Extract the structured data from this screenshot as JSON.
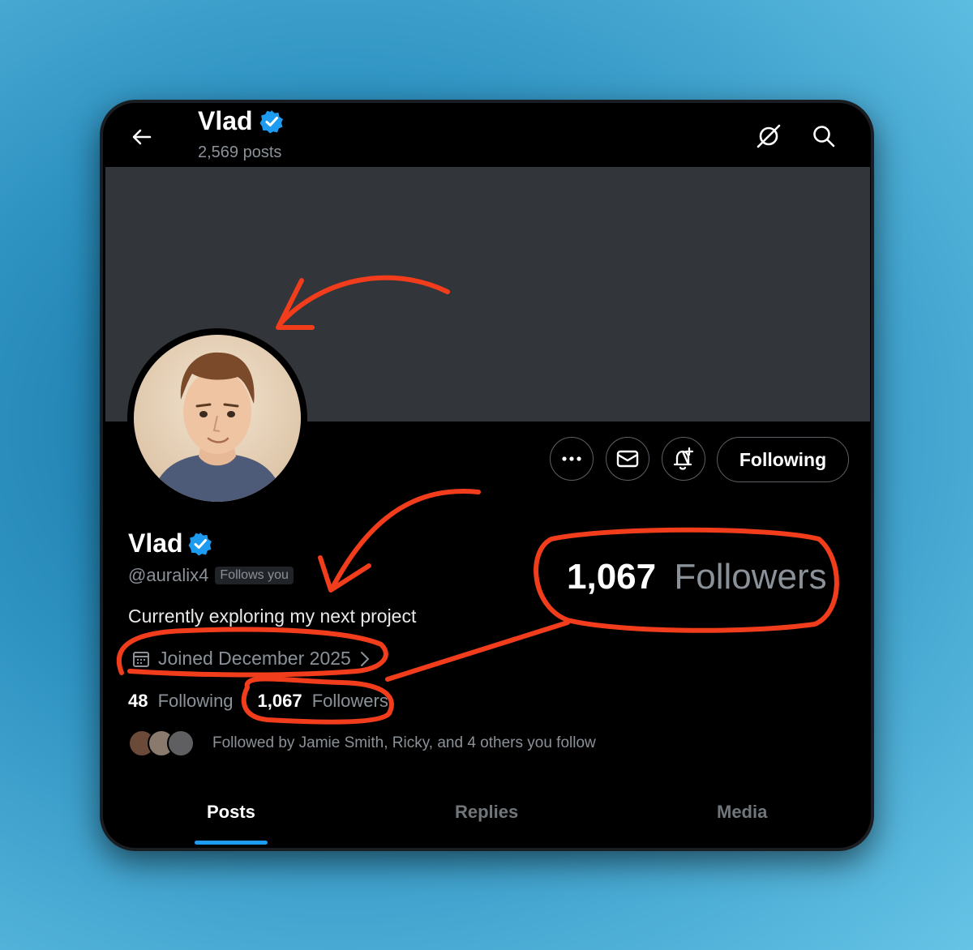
{
  "header": {
    "name": "Vlad",
    "posts_count": "2,569 posts"
  },
  "profile": {
    "name": "Vlad",
    "handle": "@auralix4",
    "follows_you": "Follows you",
    "bio": "Currently exploring my next project",
    "joined": "Joined December 2025",
    "following_count": "48",
    "following_label": "Following",
    "followers_count": "1,067",
    "followers_label": "Followers",
    "followed_by": "Followed by Jamie Smith, Ricky, and 4 others you follow"
  },
  "actions": {
    "follow_button": "Following"
  },
  "callout": {
    "followers_count": "1,067",
    "followers_label": "Followers"
  },
  "tabs": [
    {
      "label": "Posts",
      "active": true
    },
    {
      "label": "Replies",
      "active": false
    },
    {
      "label": "Media",
      "active": false
    }
  ],
  "icons": {
    "back": "back-arrow-icon",
    "grok": "grok-icon",
    "search": "search-icon",
    "verified": "verified-badge-icon",
    "more": "more-icon",
    "message": "envelope-icon",
    "notify": "bell-plus-icon",
    "calendar": "calendar-icon"
  },
  "colors": {
    "background": "#000000",
    "banner": "#323539",
    "accent": "#1d9bf0",
    "annotation": "#f23d1d"
  }
}
